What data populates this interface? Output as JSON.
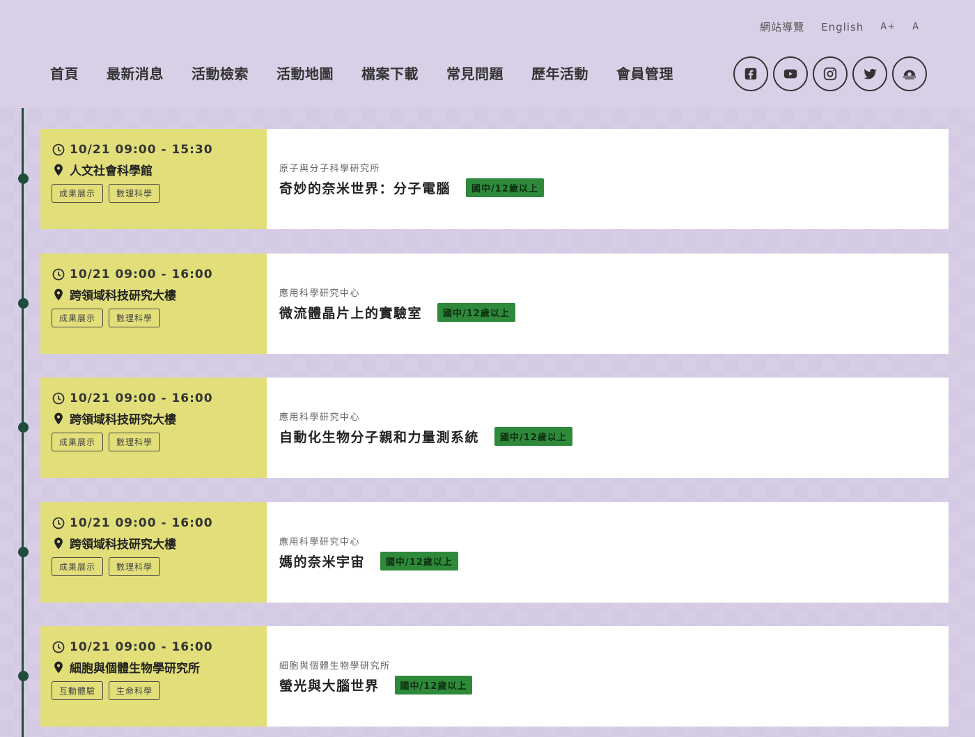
{
  "utility": {
    "sitemap": "網站導覽",
    "english": "English",
    "font_larger": "A+",
    "font_normal": "A"
  },
  "nav": [
    {
      "label": "首頁"
    },
    {
      "label": "最新消息"
    },
    {
      "label": "活動檢索"
    },
    {
      "label": "活動地圖"
    },
    {
      "label": "檔案下載"
    },
    {
      "label": "常見問題"
    },
    {
      "label": "歷年活動"
    },
    {
      "label": "會員管理"
    }
  ],
  "social": [
    "facebook-icon",
    "youtube-icon",
    "instagram-icon",
    "twitter-icon",
    "academia-sinica-icon"
  ],
  "colors": {
    "header_bg": "#d9d0e8",
    "card_left": "#e2df7a",
    "timeline": "#1e4d3a",
    "age_badge": "#2e8a3a"
  },
  "events": [
    {
      "time": "10/21 09:00 - 15:30",
      "location": "人文社會科學館",
      "tags": [
        "成果展示",
        "數理科學"
      ],
      "org": "原子與分子科學研究所",
      "title": "奇妙的奈米世界：分子電腦",
      "age": "國中/12歲以上"
    },
    {
      "time": "10/21 09:00 - 16:00",
      "location": "跨領域科技研究大樓",
      "tags": [
        "成果展示",
        "數理科學"
      ],
      "org": "應用科學研究中心",
      "title": "微流體晶片上的實驗室",
      "age": "國中/12歲以上"
    },
    {
      "time": "10/21 09:00 - 16:00",
      "location": "跨領域科技研究大樓",
      "tags": [
        "成果展示",
        "數理科學"
      ],
      "org": "應用科學研究中心",
      "title": "自動化生物分子親和力量測系統",
      "age": "國中/12歲以上"
    },
    {
      "time": "10/21 09:00 - 16:00",
      "location": "跨領域科技研究大樓",
      "tags": [
        "成果展示",
        "數理科學"
      ],
      "org": "應用科學研究中心",
      "title": "媽的奈米宇宙",
      "age": "國中/12歲以上"
    },
    {
      "time": "10/21 09:00 - 16:00",
      "location": "細胞與個體生物學研究所",
      "tags": [
        "互動體驗",
        "生命科學"
      ],
      "org": "細胞與個體生物學研究所",
      "title": "螢光與大腦世界",
      "age": "國中/12歲以上"
    }
  ]
}
